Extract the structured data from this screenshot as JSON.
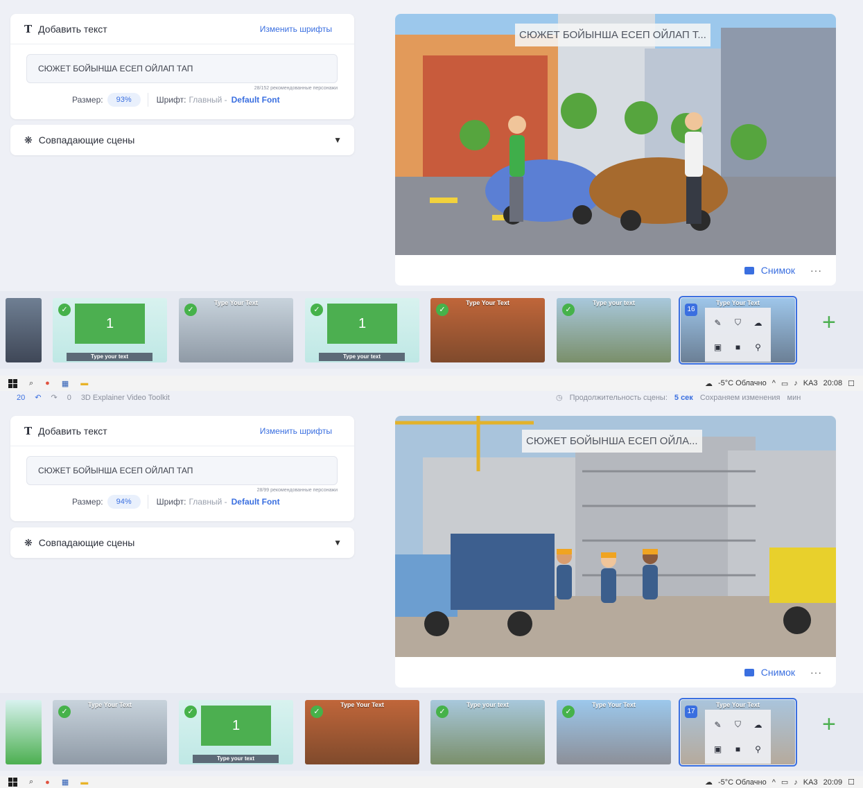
{
  "text_panel": {
    "title": "Добавить текст",
    "change_fonts": "Изменить шрифты",
    "size_label": "Размер:",
    "font_label": "Шрифт:",
    "font_prefix": "Главный -",
    "font_name": "Default Font"
  },
  "matching_scenes": "Совпадающие сцены",
  "snapshot": "Снимок",
  "more": "···",
  "panes": [
    {
      "text_value": "СЮЖЕТ БОЙЫНША ЕСЕП ОЙЛАП ТАП",
      "char_hint": "28/152 рекомендованные персонажи",
      "size": "93%",
      "overlay": "СЮЖЕТ БОЙЫНША ЕСЕП ОЙЛАП Т...",
      "active_scene": "16"
    },
    {
      "text_value": "СЮЖЕТ БОЙЫНША ЕСЕП ОЙЛАП ТАП",
      "char_hint": "28/99 рекомендованные персонажи",
      "size": "94%",
      "overlay": "СЮЖЕТ БОЙЫНША ЕСЕП ОЙЛА...",
      "active_scene": "17"
    }
  ],
  "thumb_text": {
    "upper": "Type Your Text",
    "lower": "Type your text",
    "number": "1",
    "check": "✓"
  },
  "status": {
    "undo_count": "20",
    "redo_count": "0",
    "project": "3D Explainer Video Toolkit",
    "duration_label": "Продолжительность сцены:",
    "duration_value": "5 сек",
    "saving": "Сохраняем изменения",
    "min": "мин"
  },
  "taskbar": {
    "weather": "-5°C Облачно",
    "lang": "KA3",
    "time_top": "20:08",
    "time_bottom": "20:09"
  }
}
